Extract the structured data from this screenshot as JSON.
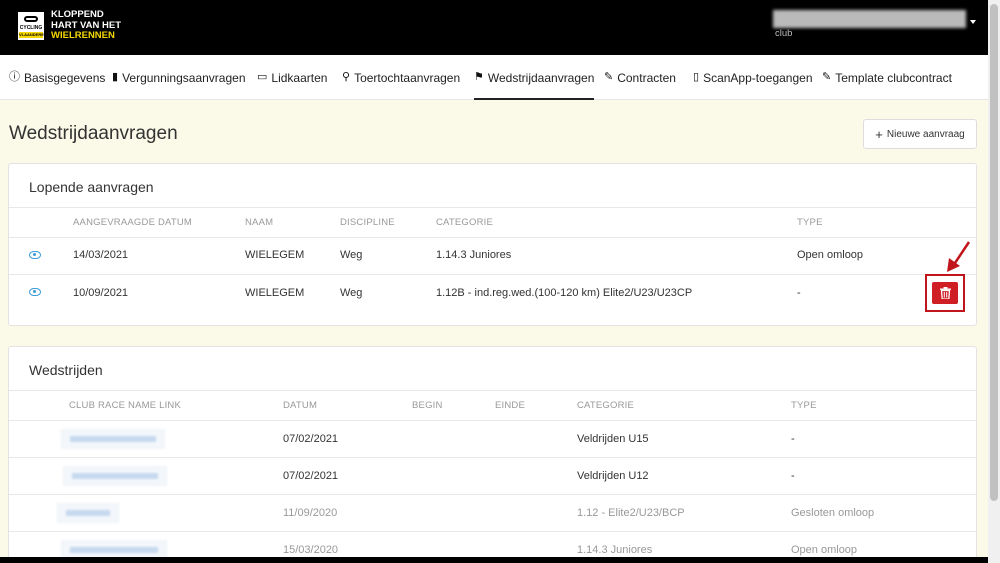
{
  "header": {
    "logo_lines": [
      "KLOPPEND",
      "HART VAN HET",
      "WIELRENNEN"
    ],
    "logo_badge": [
      "CYCLING",
      "VLAANDEREN"
    ],
    "user_sub": "club"
  },
  "nav": [
    {
      "label": "Basisgegevens",
      "icon": "info-icon"
    },
    {
      "label": "Vergunningsaanvragen",
      "icon": "license-icon"
    },
    {
      "label": "Lidkaarten",
      "icon": "card-icon"
    },
    {
      "label": "Toertochtaanvragen",
      "icon": "bicycle-icon"
    },
    {
      "label": "Wedstrijdaanvragen",
      "icon": "checkered-flag-icon",
      "active": true
    },
    {
      "label": "Contracten",
      "icon": "signature-icon"
    },
    {
      "label": "ScanApp-toegangen",
      "icon": "mobile-icon"
    },
    {
      "label": "Template clubcontract",
      "icon": "signature-icon"
    }
  ],
  "page": {
    "title": "Wedstrijdaanvragen",
    "new_button": "Nieuwe aanvraag"
  },
  "lopende": {
    "title": "Lopende aanvragen",
    "headers": [
      "AANGEVRAAGDE DATUM",
      "NAAM",
      "DISCIPLINE",
      "CATEGORIE",
      "TYPE"
    ],
    "rows": [
      {
        "date": "14/03/2021",
        "name": "WIELEGEM",
        "discipline": "Weg",
        "category": "1.14.3 Juniores",
        "type": "Open omloop"
      },
      {
        "date": "10/09/2021",
        "name": "WIELEGEM",
        "discipline": "Weg",
        "category": "1.12B - ind.reg.wed.(100-120 km) Elite2/U23/U23CP",
        "type": "-"
      }
    ]
  },
  "wedstrijden": {
    "title": "Wedstrijden",
    "headers": [
      "CLUB RACE NAME LINK",
      "DATUM",
      "BEGIN",
      "EINDE",
      "CATEGORIE",
      "TYPE"
    ],
    "rows": [
      {
        "date": "07/02/2021",
        "category": "Veldrijden U15",
        "type": "-",
        "dim": false
      },
      {
        "date": "07/02/2021",
        "category": "Veldrijden U12",
        "type": "-",
        "dim": false
      },
      {
        "date": "11/09/2020",
        "category": "1.12 - Elite2/U23/BCP",
        "type": "Gesloten omloop",
        "dim": true
      },
      {
        "date": "15/03/2020",
        "category": "1.14.3 Juniores",
        "type": "Open omloop",
        "dim": true
      }
    ]
  },
  "colors": {
    "accent_blue": "#3a9bd9",
    "delete_red": "#cf1f25",
    "brand_yellow": "#f5d800",
    "page_bg": "#fbfae8"
  }
}
